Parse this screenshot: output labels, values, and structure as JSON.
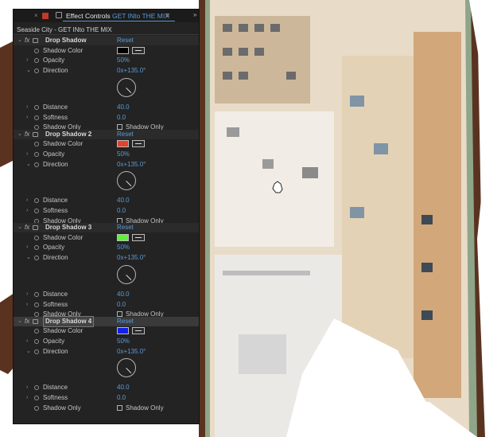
{
  "panel": {
    "tab_title": "Effect Controls",
    "tab_subject": "GET INto THE MIX",
    "header": "Seaside City - GET INto THE MIX"
  },
  "effects": [
    {
      "name": "Drop Shadow",
      "reset_label": "Reset",
      "shadow_color_label": "Shadow Color",
      "shadow_color": "#000000",
      "opacity_label": "Opacity",
      "opacity": "50%",
      "direction_label": "Direction",
      "direction": "0x+135.0°",
      "distance_label": "Distance",
      "distance": "40.0",
      "softness_label": "Softness",
      "softness": "0.0",
      "shadow_only_label": "Shadow Only",
      "shadow_only_checkbox_label": "Shadow Only"
    },
    {
      "name": "Drop Shadow 2",
      "reset_label": "Reset",
      "shadow_color_label": "Shadow Color",
      "shadow_color": "#e8402a",
      "opacity_label": "Opacity",
      "opacity": "50%",
      "direction_label": "Direction",
      "direction": "0x+135.0°",
      "distance_label": "Distance",
      "distance": "40.0",
      "softness_label": "Softness",
      "softness": "0.0",
      "shadow_only_label": "Shadow Only",
      "shadow_only_checkbox_label": "Shadow Only"
    },
    {
      "name": "Drop Shadow 3",
      "reset_label": "Reset",
      "shadow_color_label": "Shadow Color",
      "shadow_color": "#5ef03a",
      "opacity_label": "Opacity",
      "opacity": "50%",
      "direction_label": "Direction",
      "direction": "0x+135.0°",
      "distance_label": "Distance",
      "distance": "40.0",
      "softness_label": "Softness",
      "softness": "0.0",
      "shadow_only_label": "Shadow Only",
      "shadow_only_checkbox_label": "Shadow Only"
    },
    {
      "name": "Drop Shadow 4",
      "reset_label": "Reset",
      "shadow_color_label": "Shadow Color",
      "shadow_color": "#1220e8",
      "opacity_label": "Opacity",
      "opacity": "50%",
      "direction_label": "Direction",
      "direction": "0x+135.0°",
      "distance_label": "Distance",
      "distance": "40.0",
      "softness_label": "Softness",
      "softness": "0.0",
      "shadow_only_label": "Shadow Only",
      "shadow_only_checkbox_label": "Shadow Only"
    }
  ],
  "colors": {
    "panel_bg": "#232323",
    "accent_blue": "#5a9ad8",
    "outline_brown": "#5a3320"
  }
}
